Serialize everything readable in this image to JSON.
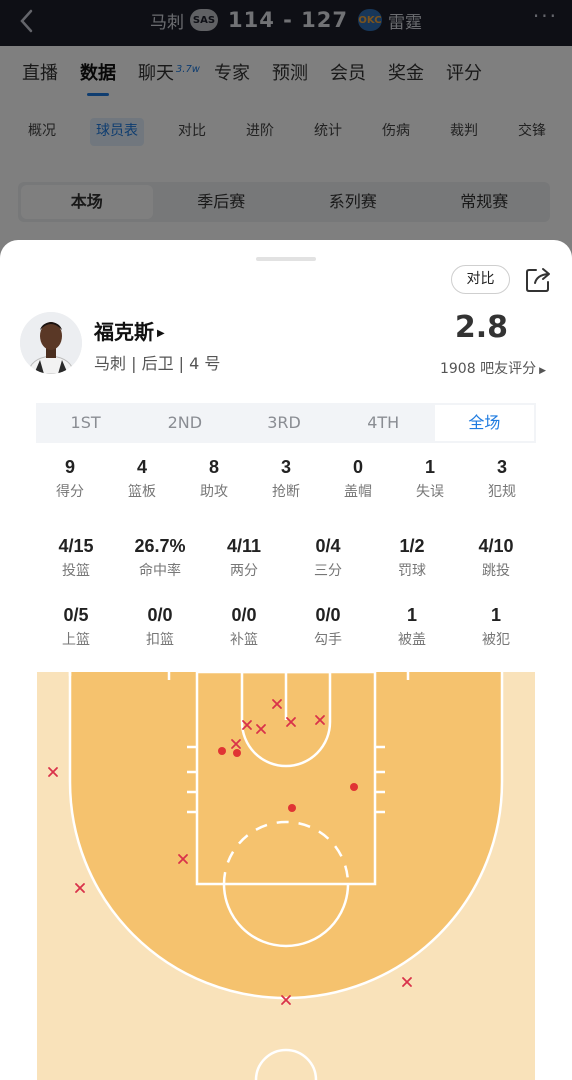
{
  "header": {
    "home_team": "马刺",
    "home_logo": "SAS",
    "score": "114 - 127",
    "away_logo": "OKC",
    "away_team": "雷霆"
  },
  "main_tabs": [
    {
      "label": "直播"
    },
    {
      "label": "数据"
    },
    {
      "label": "聊天",
      "badge": "3.7w"
    },
    {
      "label": "专家"
    },
    {
      "label": "预测"
    },
    {
      "label": "会员"
    },
    {
      "label": "奖金"
    },
    {
      "label": "评分"
    }
  ],
  "sub_tabs": [
    {
      "label": "概况"
    },
    {
      "label": "球员表"
    },
    {
      "label": "对比"
    },
    {
      "label": "进阶"
    },
    {
      "label": "统计"
    },
    {
      "label": "伤病"
    },
    {
      "label": "裁判"
    },
    {
      "label": "交锋"
    }
  ],
  "segments": [
    {
      "label": "本场"
    },
    {
      "label": "季后赛"
    },
    {
      "label": "系列赛"
    },
    {
      "label": "常规赛"
    }
  ],
  "sheet": {
    "compare_label": "对比",
    "player_name": "福克斯",
    "player_info": "马刺 | 后卫 | 4 号",
    "rating": "2.8",
    "rating_label": "1908 吧友评分",
    "periods": [
      "1ST",
      "2ND",
      "3RD",
      "4TH",
      "全场"
    ],
    "active_period": "全场",
    "stats_row1": [
      {
        "value": "9",
        "label": "得分"
      },
      {
        "value": "4",
        "label": "篮板"
      },
      {
        "value": "8",
        "label": "助攻"
      },
      {
        "value": "3",
        "label": "抢断"
      },
      {
        "value": "0",
        "label": "盖帽"
      },
      {
        "value": "1",
        "label": "失误"
      },
      {
        "value": "3",
        "label": "犯规"
      }
    ],
    "stats_row2": [
      {
        "value": "4/15",
        "label": "投篮"
      },
      {
        "value": "26.7%",
        "label": "命中率"
      },
      {
        "value": "4/11",
        "label": "两分"
      },
      {
        "value": "0/4",
        "label": "三分"
      },
      {
        "value": "1/2",
        "label": "罚球"
      },
      {
        "value": "4/10",
        "label": "跳投"
      }
    ],
    "stats_row3": [
      {
        "value": "0/5",
        "label": "上篮"
      },
      {
        "value": "0/0",
        "label": "扣篮"
      },
      {
        "value": "0/0",
        "label": "补篮"
      },
      {
        "value": "0/0",
        "label": "勾手"
      },
      {
        "value": "1",
        "label": "被盖"
      },
      {
        "value": "1",
        "label": "被犯"
      }
    ]
  },
  "colors": {
    "accent": "#1e7be0",
    "court_paint": "#f5c26e",
    "court_outer": "#f9e2ba",
    "made_shot": "#e03434",
    "missed_shot": "#d9324a"
  }
}
